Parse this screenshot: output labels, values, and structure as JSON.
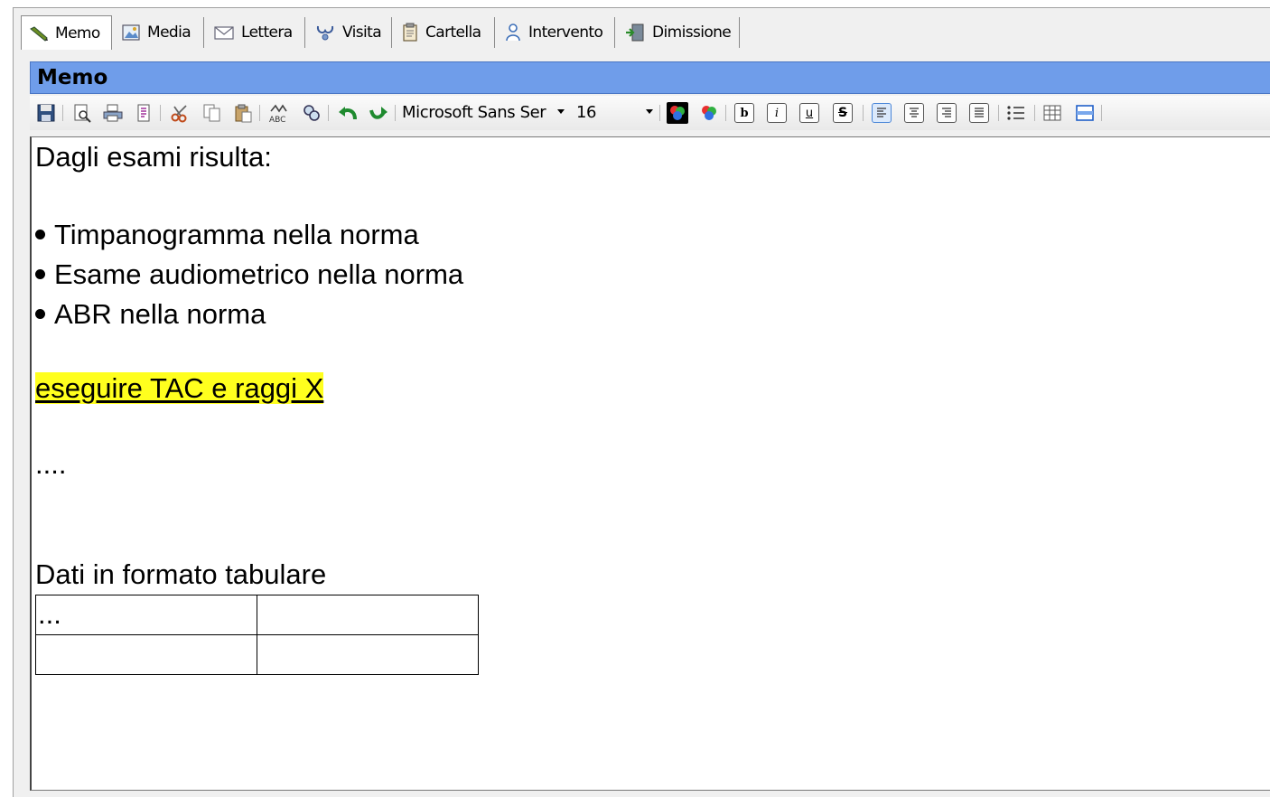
{
  "tabs": [
    {
      "label": "Memo",
      "icon": "pencil-icon",
      "active": true
    },
    {
      "label": "Media",
      "icon": "image-icon",
      "active": false
    },
    {
      "label": "Lettera",
      "icon": "envelope-icon",
      "active": false
    },
    {
      "label": "Visita",
      "icon": "stethoscope-icon",
      "active": false
    },
    {
      "label": "Cartella",
      "icon": "clipboard-icon",
      "active": false
    },
    {
      "label": "Intervento",
      "icon": "person-icon",
      "active": false
    },
    {
      "label": "Dimissione",
      "icon": "exit-door-icon",
      "active": false
    }
  ],
  "panel": {
    "title": "Memo"
  },
  "toolbar": {
    "font_name": "Microsoft Sans Ser",
    "font_size": "16",
    "buttons": [
      "save-icon",
      "print-preview-icon",
      "print-icon",
      "page-setup-icon",
      "cut-icon",
      "copy-icon",
      "paste-icon",
      "spellcheck-icon",
      "find-replace-icon",
      "undo-icon",
      "redo-icon",
      "text-color-icon",
      "highlight-color-icon",
      "bold-icon",
      "italic-icon",
      "underline-icon",
      "strikethrough-icon",
      "align-left-icon",
      "align-center-icon",
      "align-right-icon",
      "justify-icon",
      "bullet-list-icon",
      "insert-table-icon",
      "insert-row-icon"
    ]
  },
  "editor": {
    "heading": "Dagli esami risulta:",
    "bullets": [
      "Timpanogramma nella norma",
      "Esame audiometrico nella norma",
      "ABR nella norma"
    ],
    "highlighted": "eseguire TAC e raggi X",
    "ellipsis": "....",
    "table_caption": "Dati in formato tabulare",
    "table_rows": [
      [
        "...",
        ""
      ],
      [
        "",
        ""
      ]
    ]
  },
  "colors": {
    "titlebar": "#6f9dea",
    "highlight": "#ffff1e"
  }
}
